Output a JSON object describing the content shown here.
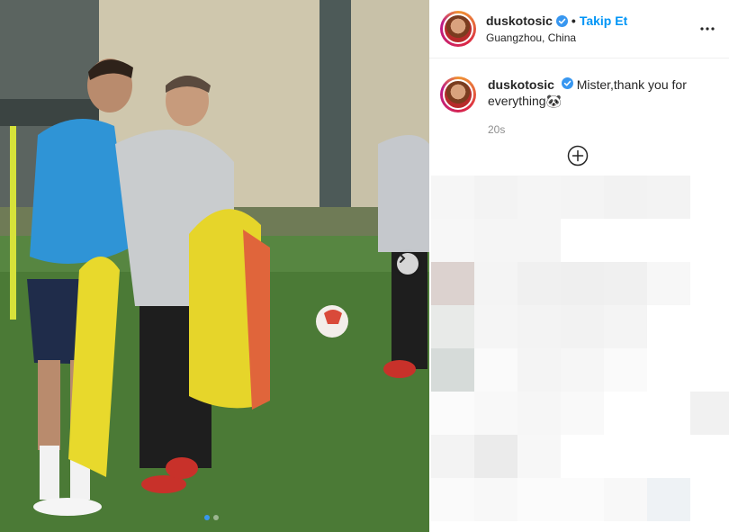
{
  "post": {
    "username": "duskotosic",
    "separator": "•",
    "follow_label": "Takip Et",
    "location": "Guangzhou, China",
    "caption_text": "Mister,thank you for everything🐼",
    "timestamp": "20s"
  },
  "icons": {
    "verified": "verified-badge-icon",
    "more": "more-options-icon",
    "next": "chevron-right-icon",
    "add_comment": "add-circle-icon"
  },
  "carousel": {
    "total": 2,
    "current": 1
  },
  "colors": {
    "follow": "#0095f6",
    "verified": "#3897f0",
    "timestamp": "#8e8e8e"
  }
}
